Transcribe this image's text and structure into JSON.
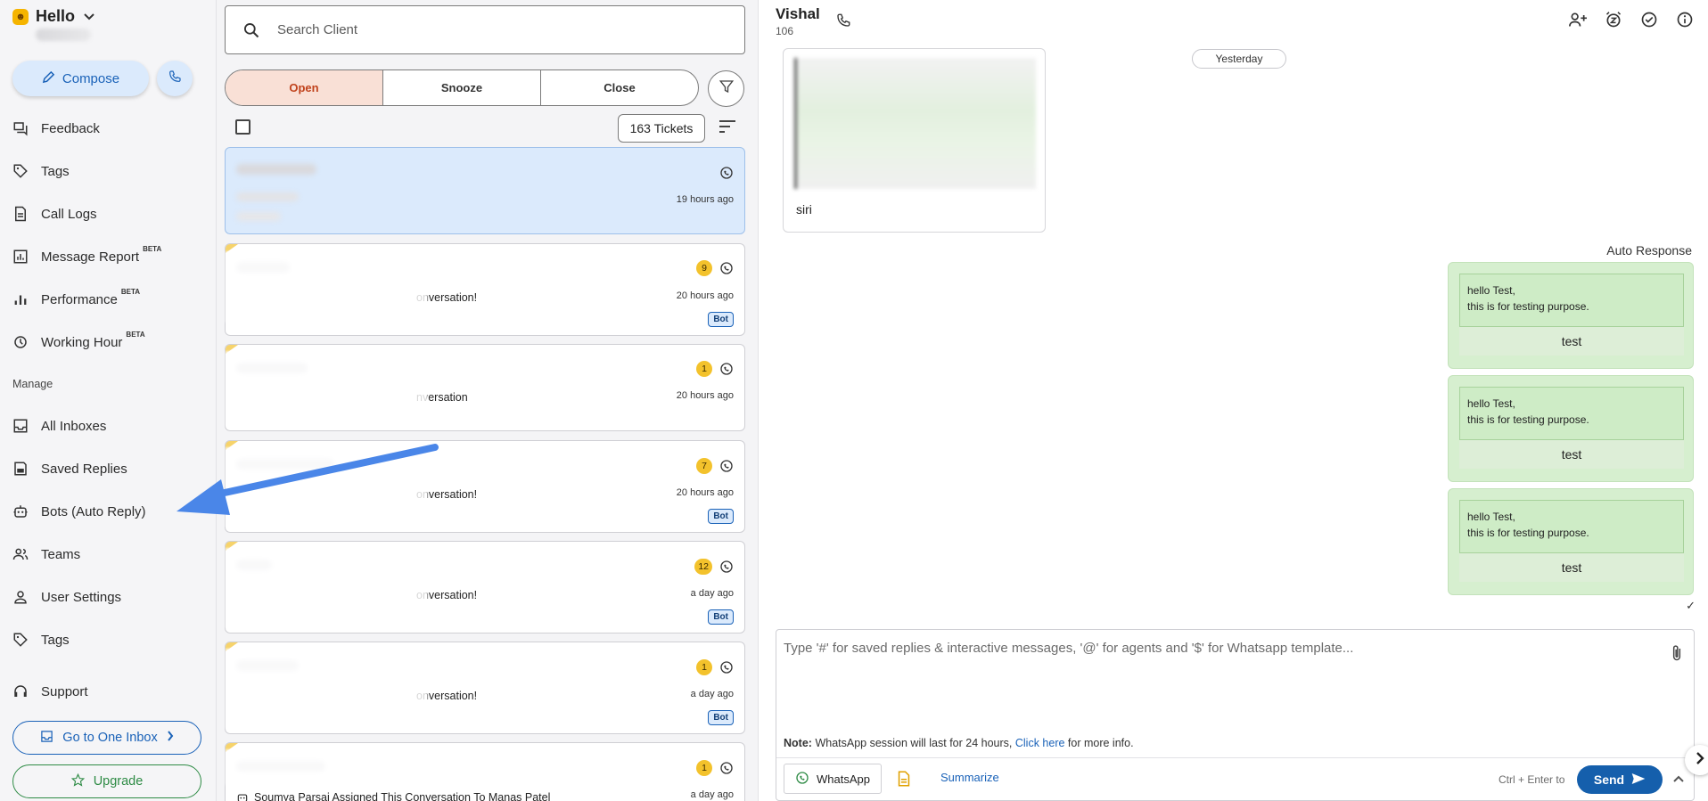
{
  "sidebar": {
    "brand": "Hello",
    "compose_label": "Compose",
    "items": [
      {
        "label": "Feedback",
        "icon": "feedback-icon"
      },
      {
        "label": "Tags",
        "icon": "tag-icon"
      },
      {
        "label": "Call Logs",
        "icon": "document-icon"
      },
      {
        "label": "Message Report",
        "icon": "bar-chart-icon",
        "beta": "BETA"
      },
      {
        "label": "Performance",
        "icon": "performance-icon",
        "beta": "BETA"
      },
      {
        "label": "Working Hour",
        "icon": "clock-icon",
        "beta": "BETA"
      }
    ],
    "manage_heading": "Manage",
    "manage_items": [
      {
        "label": "All Inboxes",
        "icon": "inbox-icon"
      },
      {
        "label": "Saved Replies",
        "icon": "save-icon"
      },
      {
        "label": "Bots (Auto Reply)",
        "icon": "robot-icon"
      },
      {
        "label": "Teams",
        "icon": "team-icon"
      },
      {
        "label": "User Settings",
        "icon": "user-icon"
      },
      {
        "label": "Tags",
        "icon": "tag-icon"
      }
    ],
    "support_label": "Support",
    "goto_label": "Go to One Inbox",
    "upgrade_label": "Upgrade"
  },
  "tickets": {
    "search_placeholder": "Search Client",
    "tabs": [
      "Open",
      "Snooze",
      "Close"
    ],
    "active_tab": "Open",
    "count_label": "163 Tickets",
    "items": [
      {
        "time": "19 hours ago",
        "selected": true
      },
      {
        "time": "20 hours ago",
        "badge": "9",
        "preview": "onversation!",
        "bot": "Bot"
      },
      {
        "time": "20 hours ago",
        "badge": "1",
        "preview": "nversation"
      },
      {
        "time": "20 hours ago",
        "badge": "7",
        "preview": "onversation!",
        "bot": "Bot"
      },
      {
        "time": "a day ago",
        "badge": "12",
        "preview": "onversation!",
        "bot": "Bot"
      },
      {
        "time": "a day ago",
        "badge": "1",
        "preview": "onversation!",
        "bot": "Bot"
      },
      {
        "time": "a day ago",
        "badge": "1",
        "preview": "Soumya Parsai Assigned This Conversation To Manas Patel"
      }
    ]
  },
  "chat": {
    "contact_name": "Vishal",
    "contact_sub": "106",
    "day_divider": "Yesterday",
    "incoming_caption": "siri",
    "auto_label": "Auto Response",
    "outgoing": [
      {
        "line1": "hello Test,",
        "line2": "this is for testing purpose.",
        "button": "test"
      },
      {
        "line1": "hello Test,",
        "line2": "this is for testing purpose.",
        "button": "test"
      },
      {
        "line1": "hello Test,",
        "line2": "this is for testing purpose.",
        "button": "test"
      }
    ],
    "composer_placeholder": "Type '#' for saved replies & interactive messages, '@' for agents and '$' for Whatsapp template...",
    "note_prefix": "Note:",
    "note_text": "WhatsApp session will last for 24 hours,",
    "note_link": "Click here",
    "note_suffix": "for more info.",
    "channel_label": "WhatsApp",
    "summarize_label": "Summarize",
    "shortcut_hint": "Ctrl + Enter to",
    "send_label": "Send"
  },
  "colors": {
    "accent": "#1a62b8",
    "open_tab": "#c0421c",
    "badge": "#f3c22c",
    "outgoing_bubble": "#d6efcf",
    "annotation_arrow": "#4a86e8"
  }
}
